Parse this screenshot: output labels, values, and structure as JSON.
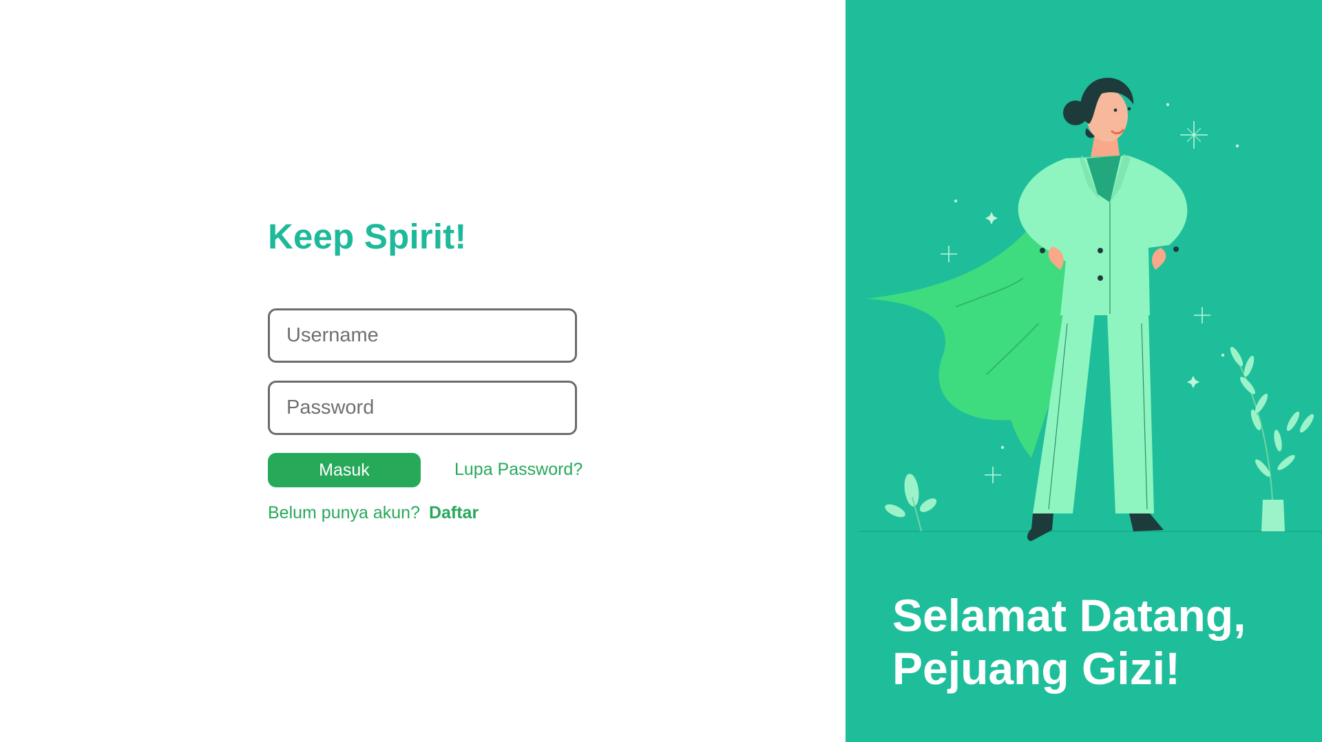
{
  "login": {
    "title": "Keep Spirit!",
    "username_placeholder": "Username",
    "password_placeholder": "Password",
    "submit_label": "Masuk",
    "forgot_label": "Lupa Password?",
    "no_account_text": "Belum punya akun?",
    "register_label": "Daftar"
  },
  "hero": {
    "welcome_line1": "Selamat Datang,",
    "welcome_line2": "Pejuang Gizi!",
    "illustration": "superhero-woman-illustration"
  },
  "colors": {
    "brand_teal": "#1ebe9a",
    "button_green": "#27a95a",
    "link_green": "#26a85a",
    "title_teal": "#1db99a"
  }
}
